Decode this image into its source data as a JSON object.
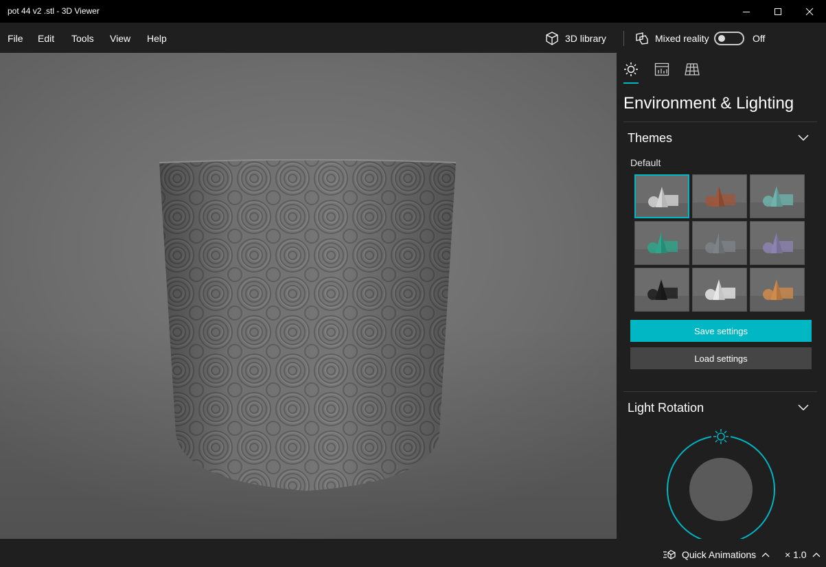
{
  "window": {
    "title": "pot 44 v2 .stl - 3D Viewer"
  },
  "menu": {
    "file": "File",
    "edit": "Edit",
    "tools": "Tools",
    "view": "View",
    "help": "Help"
  },
  "toolbar": {
    "library_label": "3D library",
    "mixed_reality_label": "Mixed reality",
    "mixed_reality_state": "Off"
  },
  "panel": {
    "title": "Environment & Lighting",
    "themes": {
      "title": "Themes",
      "selected_label": "Default",
      "items": [
        {
          "name": "default",
          "accent": "#d6d6d6"
        },
        {
          "name": "copper",
          "accent": "#a0563a"
        },
        {
          "name": "teal",
          "accent": "#6fb3ad"
        },
        {
          "name": "green",
          "accent": "#2ea58a"
        },
        {
          "name": "slate",
          "accent": "#7d8388"
        },
        {
          "name": "lavender",
          "accent": "#8c83b0"
        },
        {
          "name": "dark",
          "accent": "#1c1c1c"
        },
        {
          "name": "white",
          "accent": "#e8e8e8"
        },
        {
          "name": "orange-violet",
          "accent": "#d08a4a"
        }
      ]
    },
    "save_label": "Save settings",
    "load_label": "Load settings",
    "light_rotation": {
      "title": "Light Rotation"
    }
  },
  "statusbar": {
    "quick_animations": "Quick Animations",
    "speed": "× 1.0"
  },
  "colors": {
    "accent": "#00b7c3",
    "background": "#1f1f1f",
    "titlebar": "#000000"
  }
}
